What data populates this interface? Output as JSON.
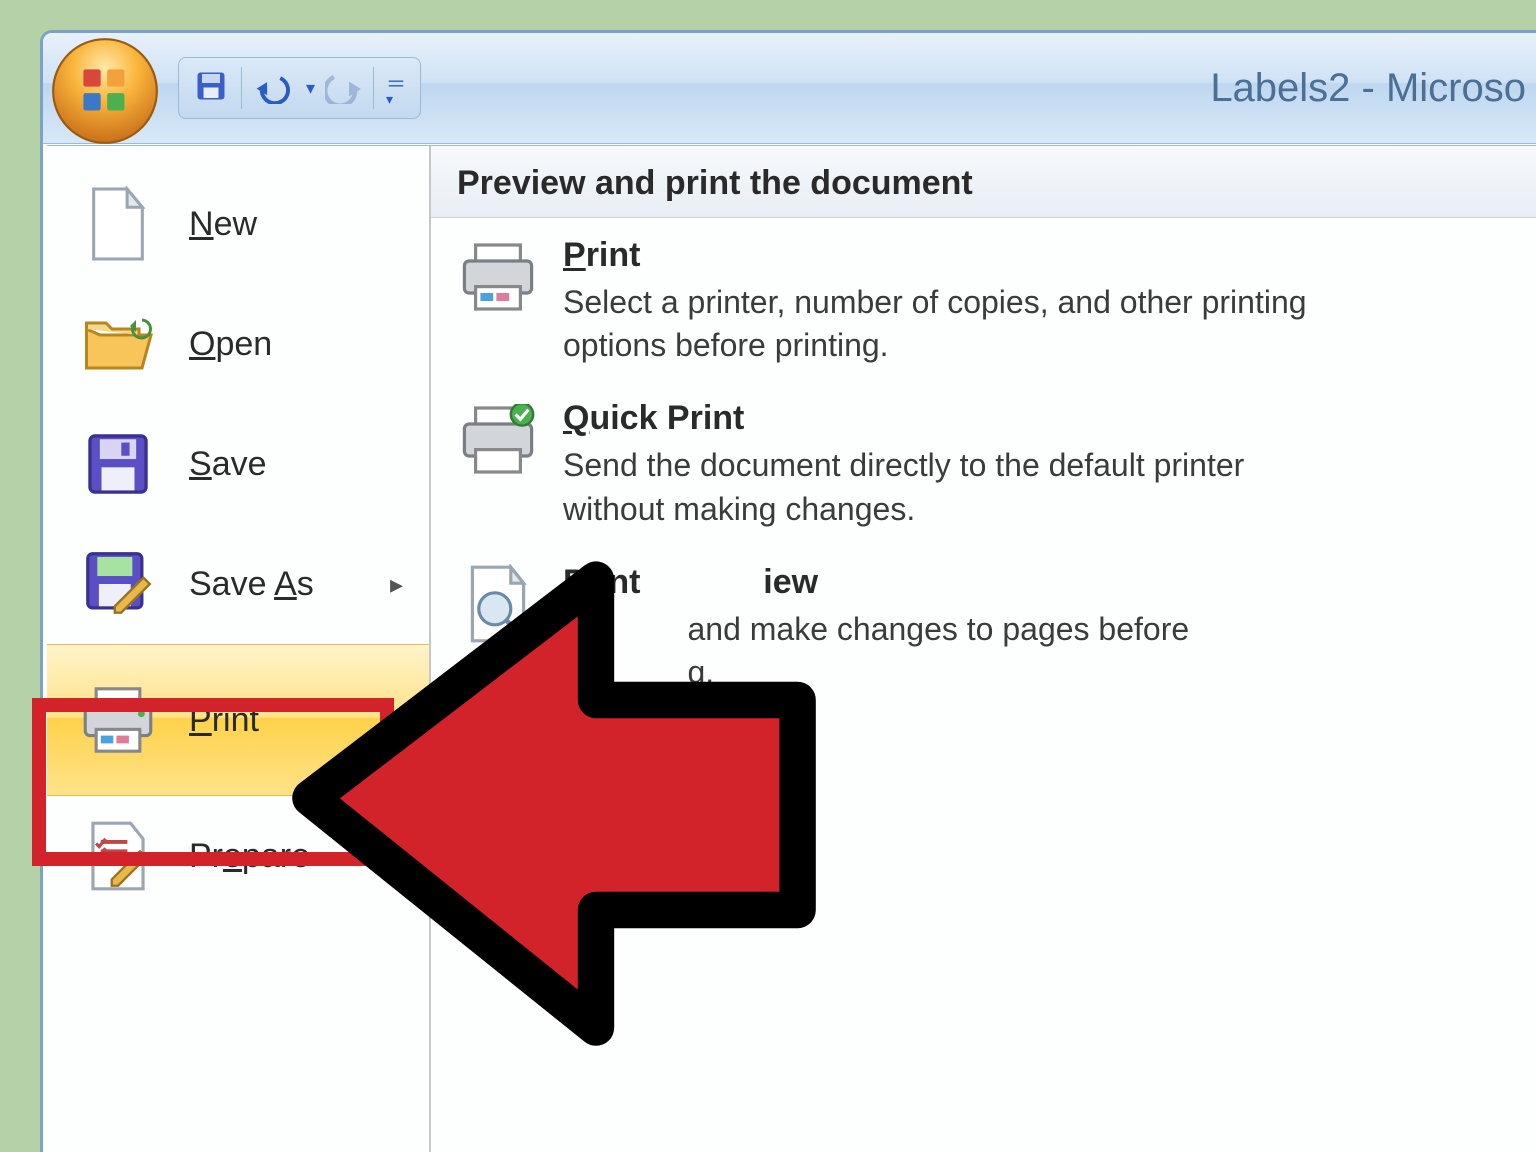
{
  "titlebar": {
    "document_title": "Labels2 - Microso"
  },
  "qat": {
    "save_tooltip": "Save",
    "undo_tooltip": "Undo",
    "redo_tooltip": "Redo"
  },
  "menu_left": {
    "new": "New",
    "open": "Open",
    "save": "Save",
    "save_as": "Save As",
    "print": "Print",
    "prepare": "Prepare"
  },
  "panel": {
    "header": "Preview and print the document",
    "print": {
      "title": "Print",
      "desc": "Select a printer, number of copies, and other printing options before printing."
    },
    "quick_print": {
      "title": "Quick Print",
      "desc": "Send the document directly to the default printer without making changes."
    },
    "preview": {
      "title_pre": "Print",
      "title_post": "iew",
      "desc_mid": "and make changes to pages before",
      "desc_end": "g."
    }
  }
}
